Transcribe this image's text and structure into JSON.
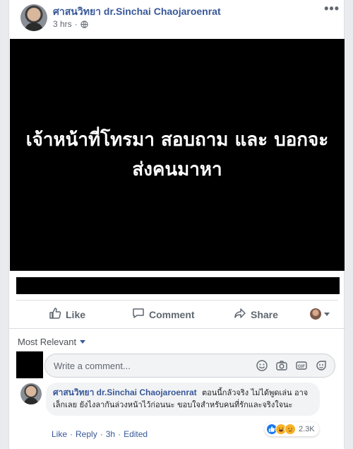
{
  "post": {
    "author": "ศาสนวิทยา dr.Sinchai Chaojaroenrat",
    "time": "3 hrs",
    "more": "•••",
    "media_text": "เจ้าหน้าที่โทรมา สอบถาม และ บอกจะส่งคนมาหา"
  },
  "actions": {
    "like": "Like",
    "comment": "Comment",
    "share": "Share"
  },
  "comments_section": {
    "sort_label": "Most Relevant",
    "composer_placeholder": "Write a comment...",
    "composer_icons": [
      "smile-icon",
      "camera-icon",
      "gif-icon",
      "sticker-icon"
    ]
  },
  "comment": {
    "author": "ศาสนวิทยา dr.Sinchai Chaojaroenrat",
    "text": "ตอนนี้กลัวจริง ไม่ได้พูดเล่น อาจเล็กเลย ยังไงลากันล่วงหน้าไว้ก่อนนะ ขอบใจสำหรับคนที่รักและจริงใจนะ",
    "like": "Like",
    "reply": "Reply",
    "time": "3h",
    "edited": "Edited",
    "sep": "·",
    "reaction_count": "2.3K",
    "reaction_icons": [
      "like-icon",
      "haha-icon",
      "sad-icon"
    ]
  },
  "colors": {
    "link_blue": "#385898",
    "background": "#e9ebee",
    "media_bg": "#000000"
  }
}
